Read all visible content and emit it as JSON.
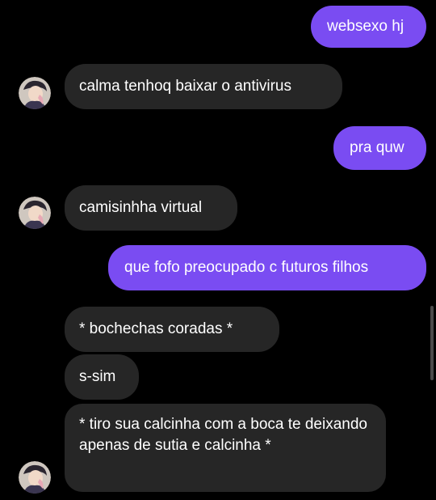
{
  "messages": [
    {
      "side": "sent",
      "text": "websexo hj"
    },
    {
      "side": "received",
      "text": "calma tenhoq baixar o antivirus"
    },
    {
      "side": "sent",
      "text": "pra quw"
    },
    {
      "side": "received",
      "text": "camisinhha virtual"
    },
    {
      "side": "sent",
      "text": "que fofo preocupado c futuros filhos"
    },
    {
      "side": "received",
      "text": "* bochechas coradas *"
    },
    {
      "side": "received",
      "text": "s-sim"
    },
    {
      "side": "received",
      "text": "* tiro sua calcinha com a boca te deixando apenas de sutia e calcinha *"
    }
  ],
  "colors": {
    "background": "#000000",
    "sent_bubble": "#7a4cf2",
    "received_bubble": "#262626",
    "text": "#ffffff"
  },
  "avatar_icon": "user-avatar-anime-icon"
}
